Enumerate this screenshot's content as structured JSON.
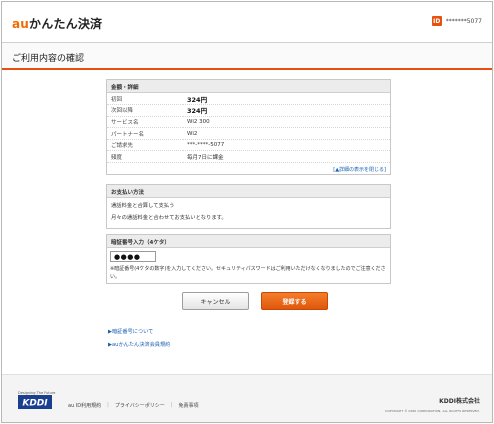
{
  "header": {
    "logo_prefix": "au",
    "logo_text": "かんたん決済",
    "id_badge": "ID",
    "id_masked": "*******5077"
  },
  "page_title": "ご利用内容の確認",
  "details": {
    "heading": "金額・詳細",
    "rows": [
      {
        "label": "初回",
        "value": "324円"
      },
      {
        "label": "次回以降",
        "value": "324円"
      },
      {
        "label": "サービス名",
        "value": "Wi2 300"
      },
      {
        "label": "パートナー名",
        "value": "Wi2"
      },
      {
        "label": "ご請求先",
        "value": "***-****-5077"
      },
      {
        "label": "頻度",
        "value": "毎月7日に課金"
      }
    ],
    "detail_link": "[▲詳細の表示を閉じる]"
  },
  "payment": {
    "heading": "お支払い方法",
    "method": "通話料金と合算して支払う",
    "note": "月々の通話料金と合わせてお支払いとなります。"
  },
  "pin": {
    "heading": "暗証番号入力（4ケタ）",
    "value": "●●●●",
    "note": "※暗証番号(4ケタの数字)を入力してください。セキュリティパスワードはご利用いただけなくなりましたのでご注意ください。"
  },
  "buttons": {
    "cancel": "キャンセル",
    "submit": "登録する"
  },
  "links": {
    "pin_about": "▶暗証番号について",
    "terms": "▶auかんたん決済会員規約"
  },
  "footer": {
    "tagline": "Designing The Future",
    "logo": "KDDI",
    "items": [
      "au ID利用規約",
      "プライバシーポリシー",
      "免責事項"
    ],
    "corp": "KDDI株式会社",
    "copyright": "COPYRIGHT © KDDI CORPORATION, ALL RIGHTS RESERVED."
  },
  "colors": {
    "accent": "#e8500f",
    "link": "#1a5fb4"
  }
}
